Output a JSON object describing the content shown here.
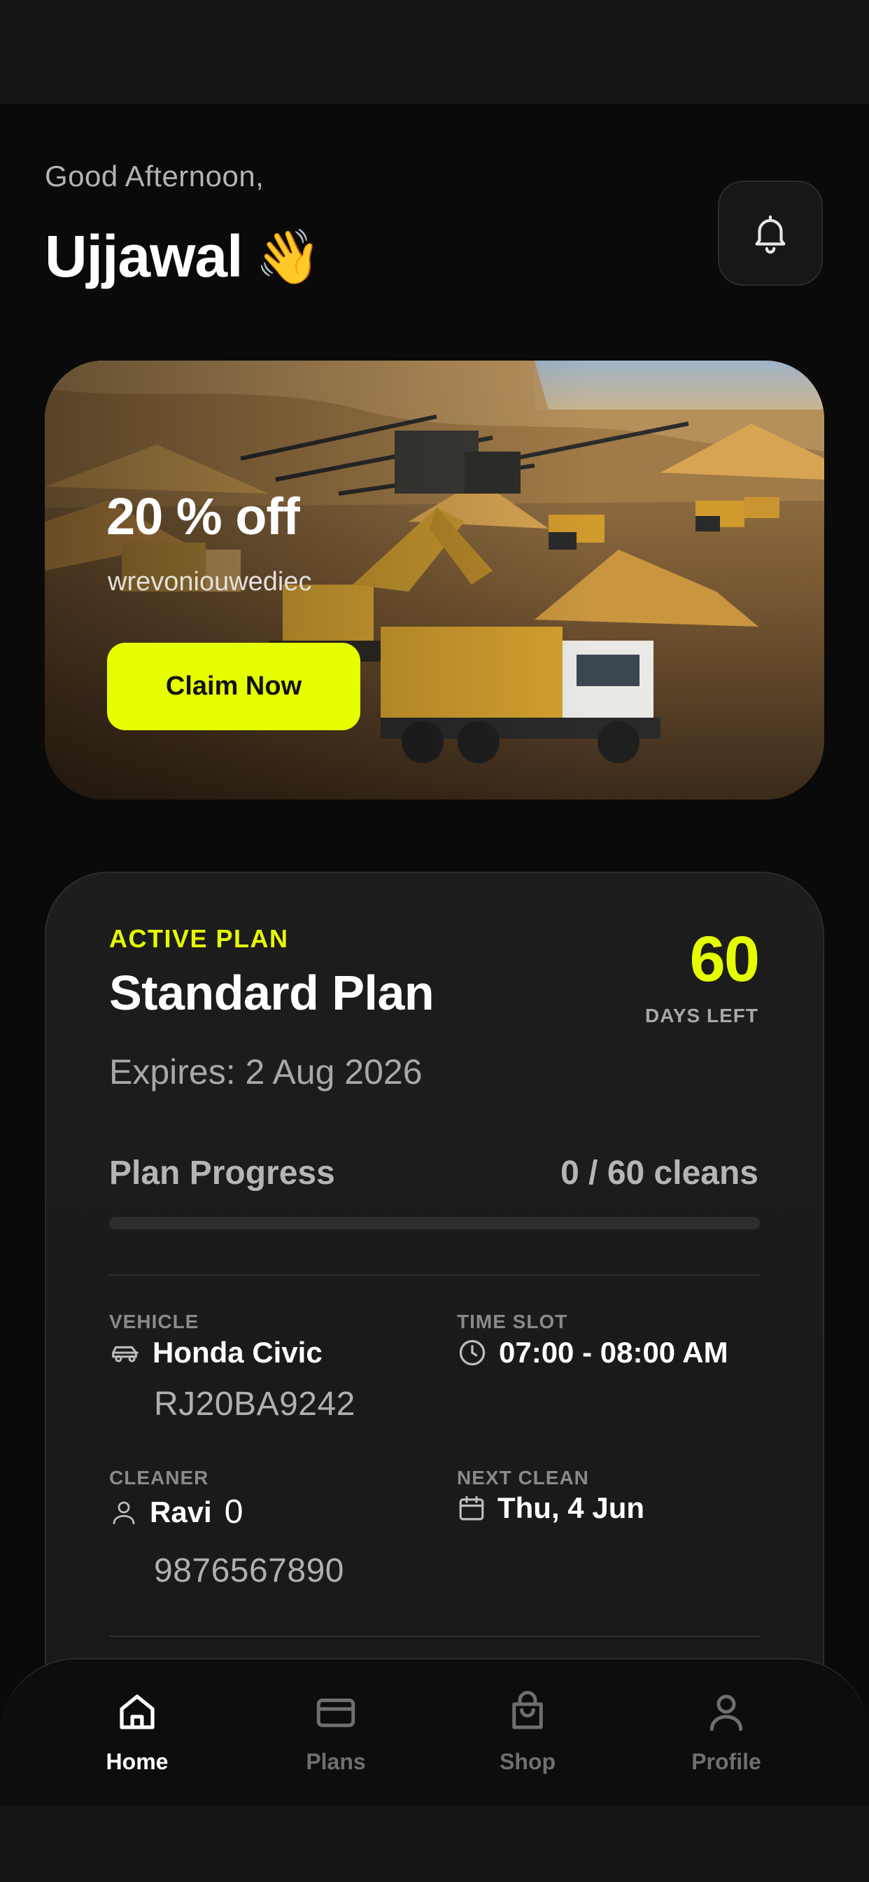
{
  "header": {
    "greeting": "Good Afternoon,",
    "user_name": "Ujjawal",
    "wave_emoji": "👋",
    "notification_icon": "bell-icon"
  },
  "promo": {
    "title": "20 % off",
    "subtitle": "wrevoniouwediec",
    "button_label": "Claim Now",
    "image": "mining-site-with-trucks-and-excavator"
  },
  "plan": {
    "status_label": "ACTIVE PLAN",
    "name": "Standard Plan",
    "days_left_value": "60",
    "days_left_label": "DAYS LEFT",
    "expires": "Expires: 2 Aug 2026",
    "progress_label": "Plan Progress",
    "progress_text": "0 / 60 cleans",
    "progress_fraction": 0,
    "vehicle": {
      "label": "VEHICLE",
      "icon": "car-icon",
      "name": "Honda Civic",
      "plate": "RJ20BA9242"
    },
    "time_slot": {
      "label": "TIME SLOT",
      "icon": "clock-icon",
      "value": "07:00 - 08:00 AM"
    },
    "cleaner": {
      "label": "CLEANER",
      "icon": "user-icon",
      "name": "Ravi",
      "count": "0",
      "phone": "9876567890"
    },
    "next_clean": {
      "label": "NEXT CLEAN",
      "icon": "calendar-icon",
      "value": "Thu, 4 Jun"
    }
  },
  "nav": {
    "items": [
      {
        "label": "Home",
        "icon": "home-icon",
        "active": true
      },
      {
        "label": "Plans",
        "icon": "card-icon",
        "active": false
      },
      {
        "label": "Shop",
        "icon": "shopping-bag-icon",
        "active": false
      },
      {
        "label": "Profile",
        "icon": "profile-icon",
        "active": false
      }
    ]
  },
  "colors": {
    "accent": "#e6ff00",
    "background": "#0a0a0a",
    "card": "#1b1b1b",
    "muted_text": "#a8a8a8"
  }
}
